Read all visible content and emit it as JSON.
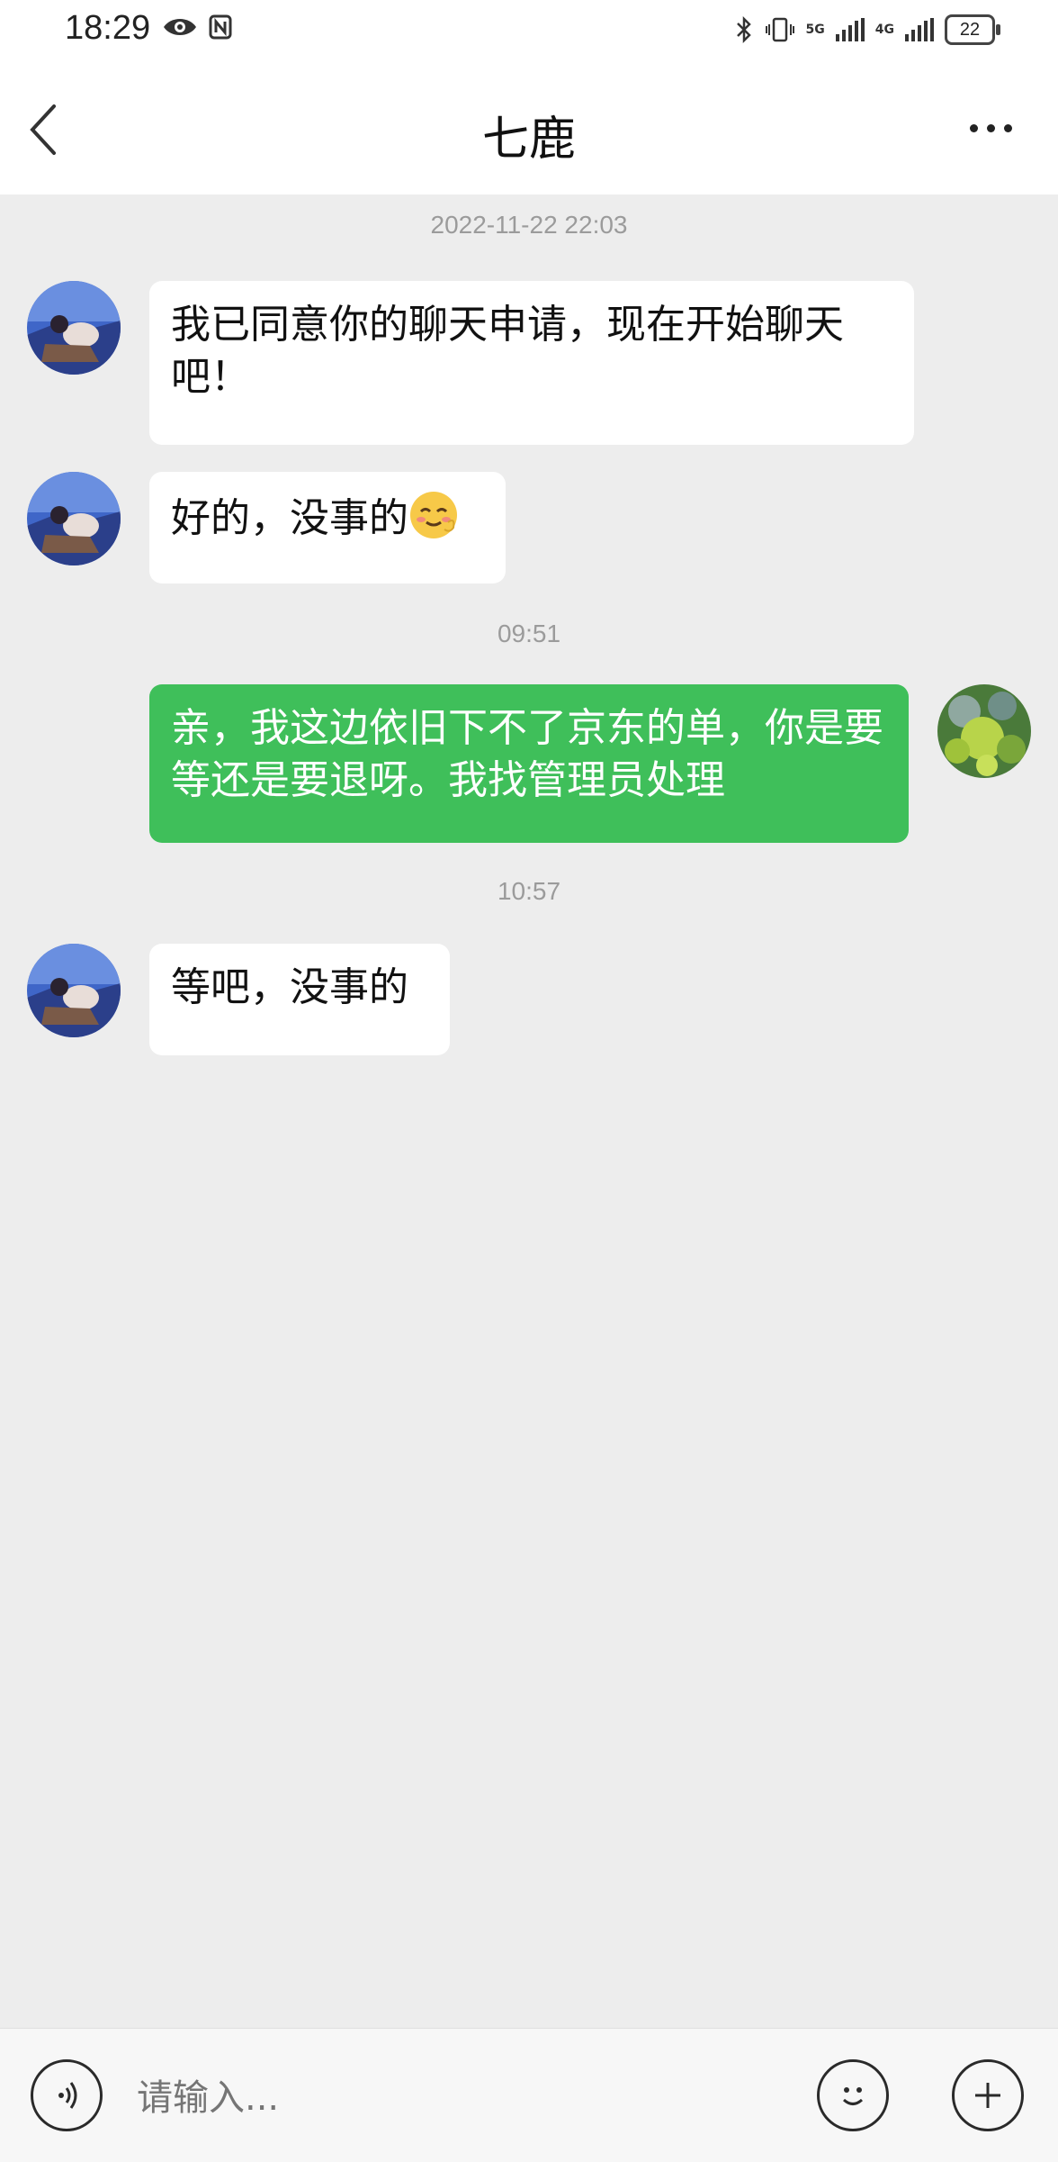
{
  "status_bar": {
    "time": "18:29",
    "battery": "22",
    "net1": "5G",
    "net2": "4G"
  },
  "header": {
    "title": "七鹿"
  },
  "messages": [
    {
      "type": "timestamp",
      "text": "2022-11-22 22:03"
    },
    {
      "type": "incoming",
      "text": "我已同意你的聊天申请，现在开始聊天吧！"
    },
    {
      "type": "incoming",
      "text": "好的，没事的",
      "emoji": "smiling-face-emoji"
    },
    {
      "type": "timestamp",
      "text": "09:51"
    },
    {
      "type": "outgoing",
      "text": "亲，我这边依旧下不了京东的单，你是要等还是要退呀。我找管理员处理"
    },
    {
      "type": "timestamp",
      "text": "10:57"
    },
    {
      "type": "incoming",
      "text": "等吧，没事的"
    }
  ],
  "input_bar": {
    "placeholder": "请输入...",
    "voice_icon": "voice-icon",
    "emoji_icon": "emoji-icon",
    "add_icon": "plus-icon"
  },
  "colors": {
    "outgoing_bubble": "#3fbf5a",
    "incoming_bubble": "#ffffff",
    "background": "#ededed"
  }
}
